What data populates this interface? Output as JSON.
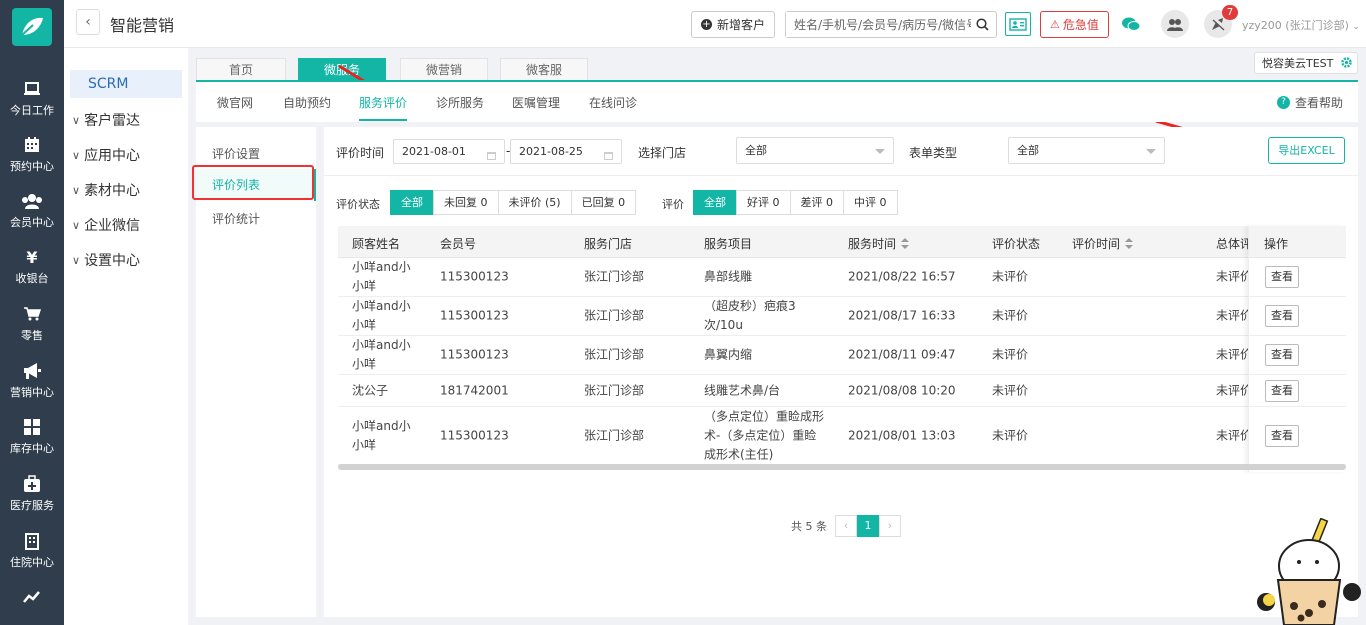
{
  "app": {
    "title": "智能营销"
  },
  "nav": [
    {
      "label": "今日工作",
      "icon": "laptop-icon"
    },
    {
      "label": "预约中心",
      "icon": "calendar-icon"
    },
    {
      "label": "会员中心",
      "icon": "users-icon"
    },
    {
      "label": "收银台",
      "icon": "yen-icon"
    },
    {
      "label": "零售",
      "icon": "cart-icon"
    },
    {
      "label": "营销中心",
      "icon": "megaphone-icon"
    },
    {
      "label": "库存中心",
      "icon": "grid-icon"
    },
    {
      "label": "医疗服务",
      "icon": "medkit-icon"
    },
    {
      "label": "住院中心",
      "icon": "building-icon"
    }
  ],
  "topbar": {
    "new_customer": "新增客户",
    "search_placeholder": "姓名/手机号/会员号/病历号/微信号",
    "danger_label": "危急值",
    "notification_count": "7",
    "user": "yzy200 (张江门诊部)"
  },
  "secondary": {
    "active": "SCRM",
    "items": [
      "客户雷达",
      "应用中心",
      "素材中心",
      "企业微信",
      "设置中心"
    ]
  },
  "tabs": [
    "首页",
    "微服务",
    "微营销",
    "微客服"
  ],
  "store_tag": "悦容美云TEST",
  "subnav": {
    "items": [
      "微官网",
      "自助预约",
      "服务评价",
      "诊所服务",
      "医嘱管理",
      "在线问诊"
    ],
    "help": "查看帮助"
  },
  "left_menu": [
    "评价设置",
    "评价列表",
    "评价统计"
  ],
  "filters": {
    "time_label": "评价时间",
    "date_from": "2021-08-01",
    "date_to": "2021-08-25",
    "store_label": "选择门店",
    "store_value": "全部",
    "form_label": "表单类型",
    "form_value": "全部",
    "export": "导出EXCEL",
    "status_label": "评价状态",
    "status_buttons": [
      "全部",
      "未回复 0",
      "未评价 (5)",
      "已回复 0"
    ],
    "rating_label": "评价",
    "rating_buttons": [
      "全部",
      "好评 0",
      "差评 0",
      "中评 0"
    ]
  },
  "table": {
    "headers": [
      "顾客姓名",
      "会员号",
      "服务门店",
      "服务项目",
      "服务时间",
      "评价状态",
      "评价时间",
      "总体评",
      "操作"
    ],
    "view_label": "查看",
    "rows": [
      {
        "name": "小咩and小小咩",
        "member": "115300123",
        "store": "张江门诊部",
        "service": "鼻部线雕",
        "time": "2021/08/22 16:57",
        "status": "未评价",
        "overall": "未评价"
      },
      {
        "name": "小咩and小小咩",
        "member": "115300123",
        "store": "张江门诊部",
        "service": "（超皮秒）疤痕3次/10u",
        "time": "2021/08/17 16:33",
        "status": "未评价",
        "overall": "未评价"
      },
      {
        "name": "小咩and小小咩",
        "member": "115300123",
        "store": "张江门诊部",
        "service": "鼻翼内缩",
        "time": "2021/08/11 09:47",
        "status": "未评价",
        "overall": "未评价"
      },
      {
        "name": "沈公子",
        "member": "181742001",
        "store": "张江门诊部",
        "service": "线雕艺术鼻/台",
        "time": "2021/08/08 10:20",
        "status": "未评价",
        "overall": "未评价"
      },
      {
        "name": "小咩and小小咩",
        "member": "115300123",
        "store": "张江门诊部",
        "service": "（多点定位）重睑成形术-（多点定位）重睑成形术(主任)",
        "time": "2021/08/01 13:03",
        "status": "未评价",
        "overall": "未评价"
      }
    ]
  },
  "pager": {
    "total": "共 5 条",
    "current": "1"
  },
  "colors": {
    "accent": "#13b5a5",
    "nav_bg": "#2f3d4c",
    "danger": "#e03c3c"
  }
}
